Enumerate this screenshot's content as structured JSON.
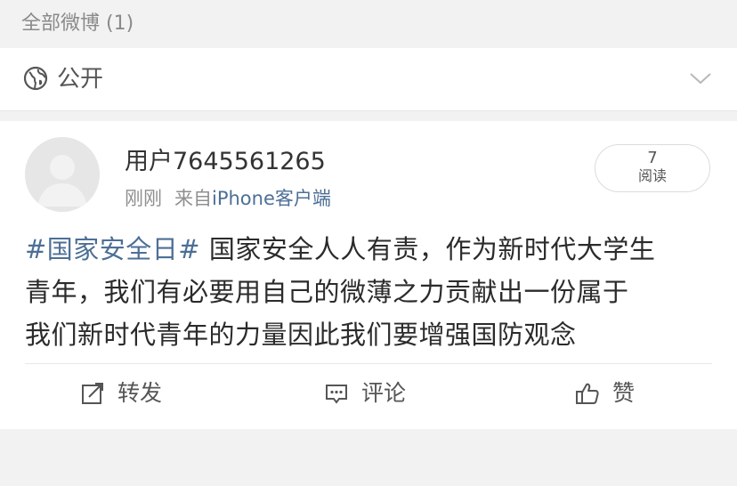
{
  "header": {
    "title": "全部微博 (1)"
  },
  "visibility": {
    "label": "公开",
    "icon": "globe-icon",
    "expand_icon": "chevron-down-icon"
  },
  "post": {
    "username": "用户7645561265",
    "time": "刚刚",
    "source_prefix": "来自",
    "source": "iPhone客户端",
    "read_count": "7",
    "read_label": "阅读",
    "hashtag": "#国家安全日#",
    "line1_rest": " 国家安全人人有责，作为新时代大学生",
    "line2": "青年，我们有必要用自己的微薄之力贡献出一份属于",
    "line3": "我们新时代青年的力量因此我们要增强国防观念"
  },
  "actions": {
    "repost_label": "转发",
    "comment_label": "评论",
    "like_label": "赞"
  },
  "colors": {
    "link": "#4d6f96",
    "background": "#f2f2f2",
    "card": "#ffffff"
  }
}
